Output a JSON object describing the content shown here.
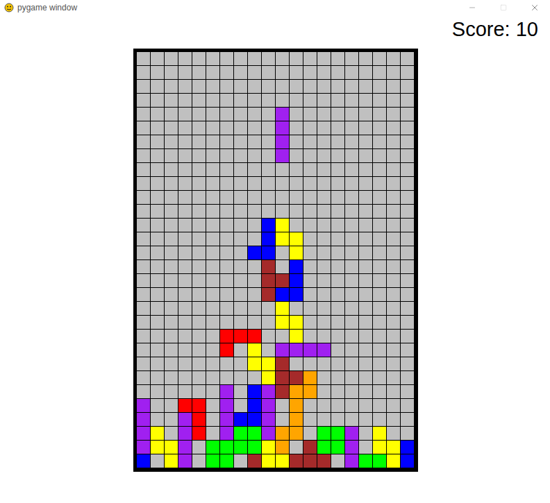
{
  "window": {
    "title": "pygame window"
  },
  "score": {
    "text": "Score: 10"
  },
  "board": {
    "columns": 20,
    "legend": {
      "P": "#a020f0",
      "B": "#0000ff",
      "Y": "#ffff00",
      "R": "#ff0000",
      "N": "#a52a2a",
      "O": "#ffa500",
      "G": "#00ff00"
    },
    "rows": [
      "....................",
      "....................",
      "....................",
      "....................",
      "..........P.........",
      "..........P.........",
      "..........P.........",
      "..........P.........",
      "....................",
      "....................",
      "....................",
      "....................",
      ".........BY.........",
      ".........BYY........",
      "........BB.Y........",
      ".........N.B........",
      ".........NNB........",
      ".........NBB........",
      "..........Y.........",
      "..........YY........",
      "......RRR..Y........",
      "......R.Y.PPPP......",
      "........YYN.........",
      ".........YNNO.......",
      "......P.BPNOO.......",
      "P..RR.P.BP.O........",
      "P..PR.PBBP.O........",
      "PY.PR.PGGPOO.GGP.Y..",
      "PYYP.GGGGYO.NGGP.YYB",
      "B.YP.GG.NYYNNN.PGGYB"
    ]
  }
}
